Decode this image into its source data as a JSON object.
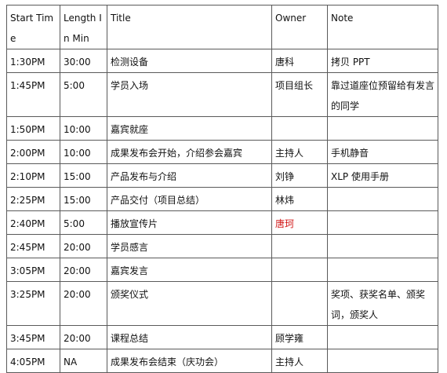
{
  "header": {
    "time": "Start Time",
    "length": "Length In Min",
    "title": "Title",
    "owner": "Owner",
    "note": "Note"
  },
  "rows": [
    {
      "time": "1:30PM",
      "length": "30:00",
      "title": "检测设备",
      "owner": "唐科",
      "note": "拷贝 PPT"
    },
    {
      "time": "1:45PM",
      "length": "5:00",
      "title": "学员入场",
      "owner": "项目组长",
      "note": "靠过道座位预留给有发言的同学"
    },
    {
      "time": "1:50PM",
      "length": "10:00",
      "title": "嘉宾就座",
      "owner": "",
      "note": ""
    },
    {
      "time": "2:00PM",
      "length": "10:00",
      "title": "成果发布会开始，介绍参会嘉宾",
      "owner": "主持人",
      "note": "手机静音"
    },
    {
      "time": "2:10PM",
      "length": "15:00",
      "title": "产品发布与介绍",
      "owner": "刘铮",
      "note": "XLP 使用手册"
    },
    {
      "time": "2:25PM",
      "length": "15:00",
      "title": "产品交付（项目总结）",
      "owner": "林炜",
      "note": ""
    },
    {
      "time": "2:40PM",
      "length": "5:00",
      "title": "播放宣传片",
      "owner": "唐珂",
      "note": ""
    },
    {
      "time": "2:45PM",
      "length": "20:00",
      "title": "学员感言",
      "owner": "",
      "note": ""
    },
    {
      "time": "3:05PM",
      "length": "20:00",
      "title": "嘉宾发言",
      "owner": "",
      "note": ""
    },
    {
      "time": "3:25PM",
      "length": "20:00",
      "title": "颁奖仪式",
      "owner": "",
      "note": "奖项、获奖名单、颁奖词，颁奖人"
    },
    {
      "time": "3:45PM",
      "length": "20:00",
      "title": "课程总结",
      "owner": "顾学雍",
      "note": ""
    },
    {
      "time": "4:05PM",
      "length": "NA",
      "title": "成果发布会结束（庆功会）",
      "owner": "主持人",
      "note": ""
    }
  ],
  "colors": {
    "owner_highlight": "#d21b1b"
  }
}
